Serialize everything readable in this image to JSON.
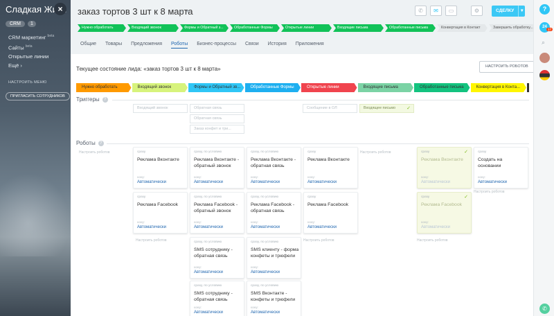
{
  "sidebar": {
    "title": "Сладкая Жизн",
    "crm_label": "CRM",
    "crm_count": "1",
    "menu": [
      {
        "label": "CRM маркетинг",
        "sup": "beta"
      },
      {
        "label": "Сайты",
        "sup": "beta"
      },
      {
        "label": "Открытые линии",
        "sup": ""
      },
      {
        "label": "Ещё ›",
        "sup": ""
      }
    ],
    "settings_label": "НАСТРОИТЬ МЕНЮ",
    "invite_label": "ПРИГЛАСИТЬ СОТРУДНИКОВ"
  },
  "header": {
    "title": "заказ тортов 3 шт к 8 марта",
    "deal_button": "СДЕЛКУ"
  },
  "lead_statuses": [
    {
      "label": "Нужно обработать",
      "state": "done"
    },
    {
      "label": "Входящий звонок",
      "state": "done"
    },
    {
      "label": "Формы и Обратный з...",
      "state": "done"
    },
    {
      "label": "Обработанные Формы",
      "state": "done"
    },
    {
      "label": "Открытые линии",
      "state": "done"
    },
    {
      "label": "Входящие письма",
      "state": "done"
    },
    {
      "label": "Обработанные письма",
      "state": "done"
    },
    {
      "label": "Конвертация в Контакт",
      "state": "current"
    },
    {
      "label": "Завершить обработку...",
      "state": "todo"
    }
  ],
  "tabs": [
    {
      "label": "Общие",
      "active": false
    },
    {
      "label": "Товары",
      "active": false
    },
    {
      "label": "Предложения",
      "active": false
    },
    {
      "label": "Роботы",
      "active": true
    },
    {
      "label": "Бизнес-процессы",
      "active": false
    },
    {
      "label": "Связи",
      "active": false
    },
    {
      "label": "История",
      "active": false
    },
    {
      "label": "Приложения",
      "active": false
    }
  ],
  "content": {
    "current_state": "Текущее состояние лида: «заказ тортов 3 шт к 8 марта»",
    "configure_robots": "НАСТРОИТЬ РОБОТОВ",
    "triggers_title": "Триггеры",
    "robots_title": "Роботы",
    "configure_robots_hint": "Настроить роботов"
  },
  "stages": [
    {
      "label": "Нужно обработать",
      "color": "#ff9a00",
      "text": "#333333"
    },
    {
      "label": "Входящий звонок",
      "color": "#d7f37c",
      "text": "#333333"
    },
    {
      "label": "Формы и Обратный зв...",
      "color": "#2fc6f6",
      "text": "#333333"
    },
    {
      "label": "Обработанные Формы",
      "color": "#1eaff0",
      "text": "#ffffff"
    },
    {
      "label": "Открытые линии",
      "color": "#f0444e",
      "text": "#ffffff"
    },
    {
      "label": "Входящие письма",
      "color": "#7bd3a5",
      "text": "#333333"
    },
    {
      "label": "Обработанные письма",
      "color": "#13c37f",
      "text": "#333333"
    },
    {
      "label": "Конвертация в Конта...",
      "color": "#fff600",
      "text": "#333333"
    }
  ],
  "triggers": [
    {
      "label": "Входящий звонок",
      "style": "plain"
    },
    {
      "label": "Обратная связь",
      "style": "plain"
    },
    {
      "label": "Обратная связь",
      "style": "plain"
    },
    {
      "label": "Заказ конфет и три...",
      "style": "plain"
    },
    {
      "label": "Сообщение в ОЛ",
      "style": "plain"
    },
    {
      "label": "Входящее письмо",
      "style": "green"
    }
  ],
  "robot_when_immediate": "сразу",
  "robot_when_condition": "сразу, по условию",
  "robot_who": "кому:",
  "robot_auto": "Автоматически",
  "robots": [
    {
      "title": "Реклама Вконтакте",
      "when": "сразу",
      "green": false
    },
    {
      "title": "Реклама Вконтакте - обратный звонок",
      "when": "сразу, по условию",
      "green": false
    },
    {
      "title": "Реклама Вконтакте - обратная связь",
      "when": "сразу, по условию",
      "green": false
    },
    {
      "title": "Реклама Вконтакте",
      "when": "сразу",
      "green": false
    },
    {
      "title": "Реклама Вконтакте",
      "when": "сразу",
      "green": true
    },
    {
      "title": "Создать на основании",
      "when": "сразу",
      "green": false
    },
    {
      "title": "Реклама Facebook",
      "when": "сразу",
      "green": false
    },
    {
      "title": "Реклама Facebook - обратный звонок",
      "when": "сразу, по условию",
      "green": false
    },
    {
      "title": "Реклама Facebook - обратная связь",
      "when": "сразу, по условию",
      "green": false
    },
    {
      "title": "Реклама Facebook",
      "when": "сразу",
      "green": false
    },
    {
      "title": "Реклама Facebook",
      "when": "сразу",
      "green": true
    },
    {
      "title": "SMS сотруднику - обратная связь",
      "when": "сразу, по условию",
      "green": false
    },
    {
      "title": "SMS клиенту - форма конфеты и трюфели",
      "when": "сразу, по условию",
      "green": false
    },
    {
      "title": "SMS сотруднику - обратная связь",
      "when": "сразу, по условию",
      "green": false
    },
    {
      "title": "SMS Вконтакте - конфеты и трюфели",
      "when": "сразу, по условию",
      "green": false
    }
  ],
  "right_panel": {
    "help": "?",
    "b24_count": "17"
  }
}
